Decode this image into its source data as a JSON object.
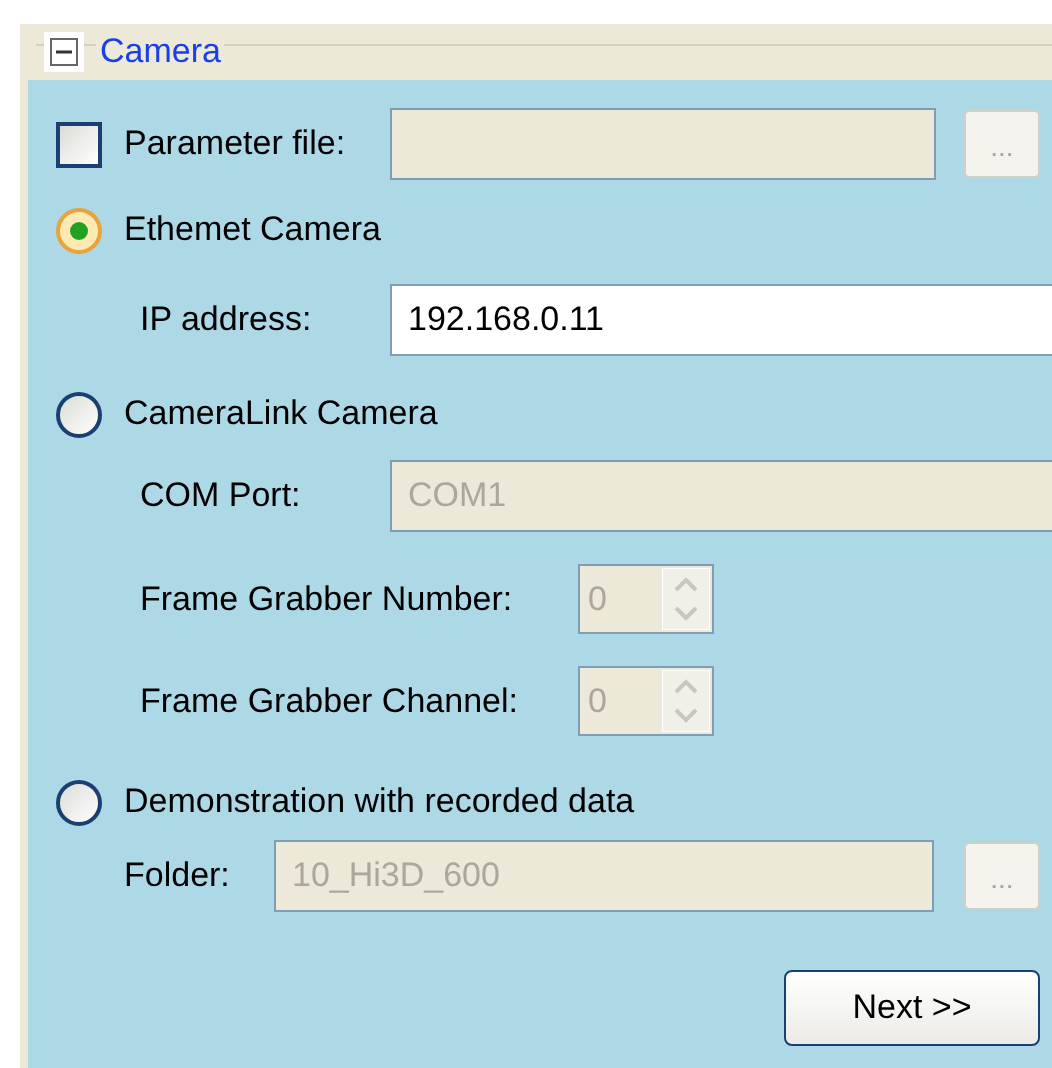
{
  "group": {
    "title": "Camera",
    "expanded": true
  },
  "rows": [
    {
      "kind": "file",
      "label": "Parameter file:",
      "checked": false,
      "disabled": true,
      "button": "..."
    },
    {
      "kind": "radio",
      "label": "Ethemet Camera",
      "selected": true
    },
    {
      "kind": "field",
      "label": "IP address:",
      "value": "192.168.0.11",
      "disabled": false
    },
    {
      "kind": "radio",
      "label": "CameraLink Camera",
      "selected": false
    },
    {
      "kind": "field",
      "label": "COM Port:",
      "value": "COM1",
      "disabled": true
    },
    {
      "kind": "spinner",
      "label": "Frame Grabber Number:",
      "value": "0",
      "disabled": true
    },
    {
      "kind": "spinner",
      "label": "Frame Grabber Channel:",
      "value": "0",
      "disabled": true
    },
    {
      "kind": "radio",
      "label": "Demonstration with recorded data",
      "selected": false
    },
    {
      "kind": "folder",
      "label": "Folder:",
      "value": "10_Hi3D_600",
      "disabled": true,
      "button": "..."
    }
  ],
  "next_button": "Next >>"
}
